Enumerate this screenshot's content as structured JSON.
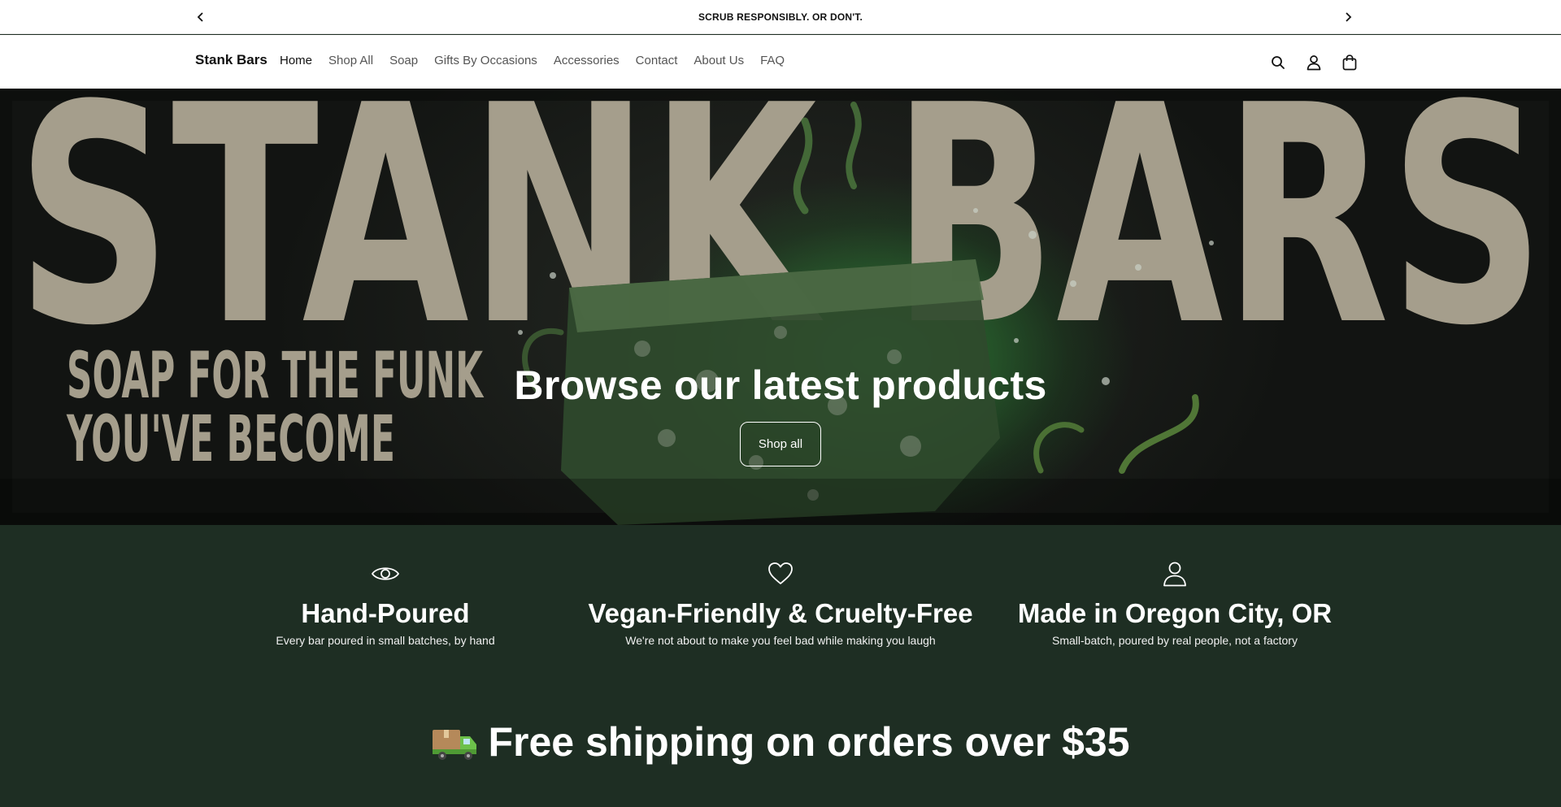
{
  "announcement": {
    "text": "SCRUB RESPONSIBLY. OR DON'T."
  },
  "header": {
    "brand": "Stank Bars",
    "nav": [
      {
        "label": "Home"
      },
      {
        "label": "Shop All"
      },
      {
        "label": "Soap"
      },
      {
        "label": "Gifts By Occasions"
      },
      {
        "label": "Accessories"
      },
      {
        "label": "Contact"
      },
      {
        "label": "About Us"
      },
      {
        "label": "FAQ"
      }
    ],
    "icons": [
      "search-icon",
      "account-icon",
      "cart-icon"
    ]
  },
  "hero": {
    "image_text_big": "STANK BARS",
    "image_text_line1": "SOAP FOR THE FUNK",
    "image_text_line2": "YOU'VE BECOME",
    "title": "Browse our latest products",
    "button": "Shop all"
  },
  "features": [
    {
      "icon": "eye-icon",
      "title": "Hand-Poured",
      "desc": "Every bar poured in small batches, by hand"
    },
    {
      "icon": "heart-icon",
      "title": "Vegan-Friendly & Cruelty-Free",
      "desc": "We're not about to make you feel bad while making you laugh"
    },
    {
      "icon": "person-icon",
      "title": "Made in Oregon City, OR",
      "desc": "Small-batch, poured by real people, not a factory"
    }
  ],
  "shipping": {
    "icon": "delivery-truck-icon",
    "text": "Free shipping on orders over $35"
  },
  "colors": {
    "feature_bg": "#1e2e23",
    "hero_text_tan": "#a59e8c",
    "accent_green": "#3e9a3a"
  }
}
